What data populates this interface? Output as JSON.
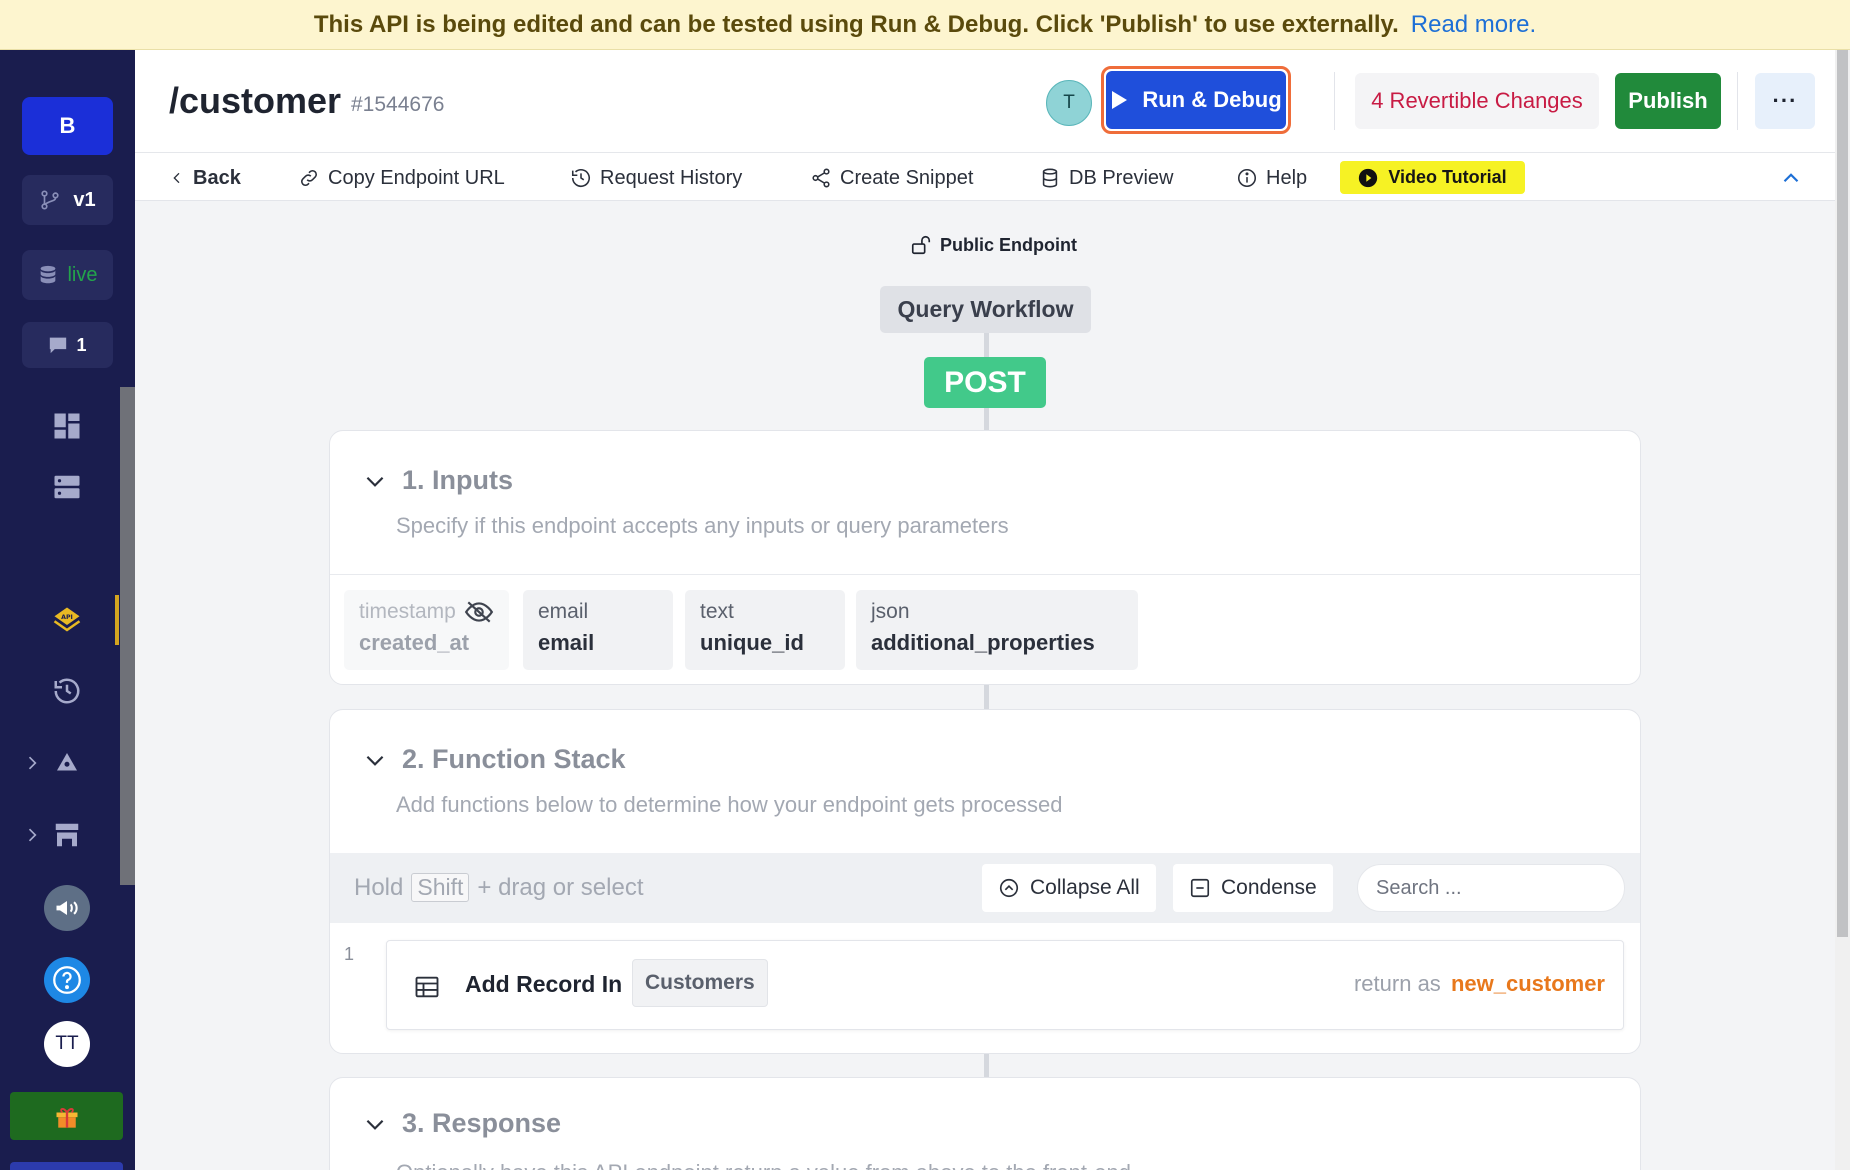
{
  "banner": {
    "message": "This API is being edited and can be tested using Run & Debug. Click 'Publish' to use externally.",
    "link": "Read more."
  },
  "sidebar": {
    "workspace": "B",
    "branch": "v1",
    "datasource": "live",
    "comments": "1",
    "user_initials": "TT"
  },
  "header": {
    "title": "/customer",
    "id": "#1544676",
    "collaborator": "T",
    "run_debug": "Run & Debug",
    "revertible": "4 Revertible Changes",
    "publish": "Publish",
    "more": "···"
  },
  "toolbar": {
    "back": "Back",
    "copy_endpoint": "Copy Endpoint URL",
    "request_history": "Request History",
    "create_snippet": "Create Snippet",
    "db_preview": "DB Preview",
    "help": "Help",
    "video_tutorial": "Video Tutorial"
  },
  "endpoint": {
    "visibility": "Public Endpoint",
    "workflow": "Query Workflow",
    "method": "POST"
  },
  "inputs": {
    "title": "1. Inputs",
    "subtitle": "Specify if this endpoint accepts any inputs or query parameters",
    "fields": [
      {
        "type": "timestamp",
        "name": "created_at",
        "hidden": true
      },
      {
        "type": "email",
        "name": "email"
      },
      {
        "type": "text",
        "name": "unique_id"
      },
      {
        "type": "json",
        "name": "additional_properties"
      }
    ]
  },
  "function_stack": {
    "title": "2. Function Stack",
    "subtitle": "Add functions below to determine how your endpoint gets processed",
    "hint_prefix": "Hold",
    "hint_key": "Shift",
    "hint_suffix": "+ drag or select",
    "collapse_all": "Collapse All",
    "condense": "Condense",
    "search_placeholder": "Search ...",
    "items": [
      {
        "index": "1",
        "title": "Add Record In",
        "table": "Customers",
        "return_label": "return as",
        "return_var": "new_customer"
      }
    ]
  },
  "response": {
    "title": "3. Response",
    "subtitle": "Optionally have this API endpoint return a value from above to the front-end"
  },
  "colors": {
    "accent": "#1f4fdb",
    "publish": "#218a3b",
    "revert": "#c81b44",
    "post": "#42c98a",
    "sidebar": "#1a1d4e"
  }
}
